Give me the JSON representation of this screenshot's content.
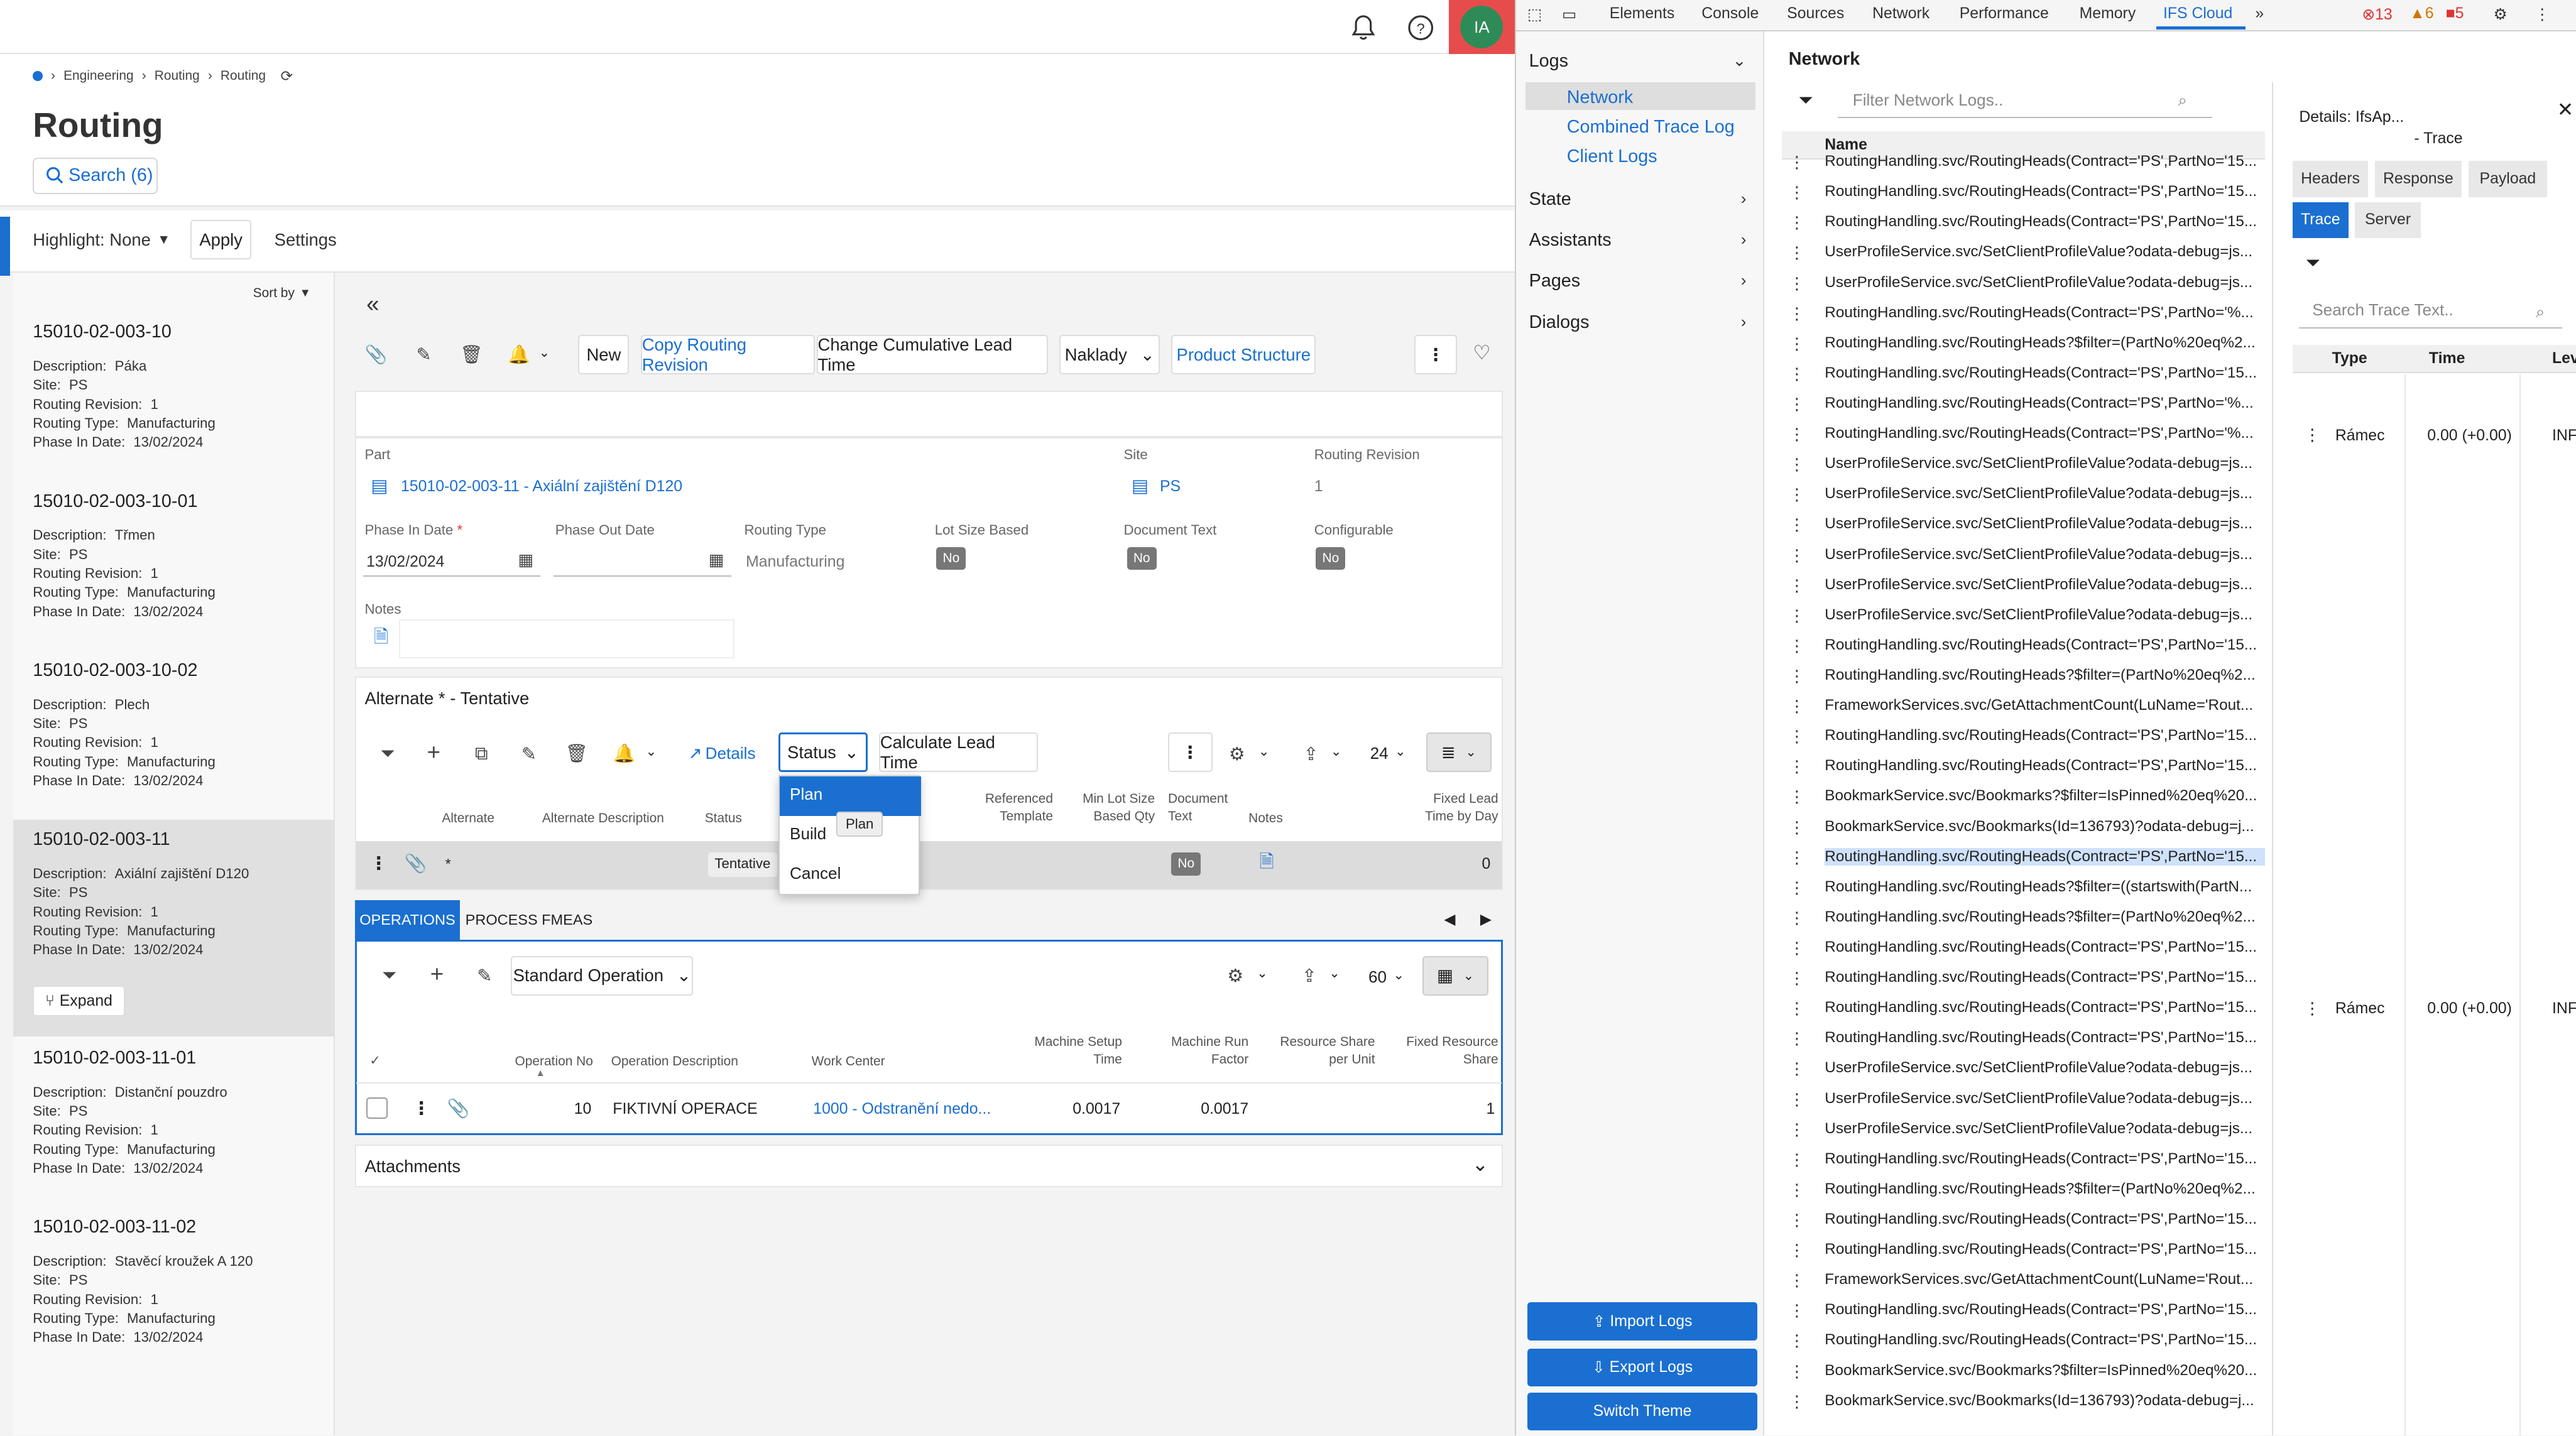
{
  "topbar": {
    "avatar_initials": "IA"
  },
  "breadcrumb": {
    "items": [
      "Engineering",
      "Routing",
      "Routing"
    ]
  },
  "page": {
    "title": "Routing",
    "search_label": "Search (6)"
  },
  "highlight": {
    "label": "Highlight: None",
    "apply": "Apply",
    "settings": "Settings"
  },
  "sort_label": "Sort by",
  "list_items": [
    {
      "id": "15010-02-003-10",
      "desc": "Páka",
      "site": "PS",
      "rev": "1",
      "type": "Manufacturing",
      "phase": "13/02/2024"
    },
    {
      "id": "15010-02-003-10-01",
      "desc": "Třmen",
      "site": "PS",
      "rev": "1",
      "type": "Manufacturing",
      "phase": "13/02/2024"
    },
    {
      "id": "15010-02-003-10-02",
      "desc": "Plech",
      "site": "PS",
      "rev": "1",
      "type": "Manufacturing",
      "phase": "13/02/2024"
    },
    {
      "id": "15010-02-003-11",
      "desc": "Axiální zajištění D120",
      "site": "PS",
      "rev": "1",
      "type": "Manufacturing",
      "phase": "13/02/2024"
    },
    {
      "id": "15010-02-003-11-01",
      "desc": "Distanční pouzdro",
      "site": "PS",
      "rev": "1",
      "type": "Manufacturing",
      "phase": "13/02/2024"
    },
    {
      "id": "15010-02-003-11-02",
      "desc": "Stavěcí kroužek A 120",
      "site": "PS",
      "rev": "1",
      "type": "Manufacturing",
      "phase": "13/02/2024"
    }
  ],
  "list_labels": {
    "desc": "Description:",
    "site": "Site:",
    "rev": "Routing Revision:",
    "type": "Routing Type:",
    "phase": "Phase In Date:",
    "expand": "Expand"
  },
  "toolbar": {
    "new": "New",
    "copy": "Copy Routing Revision",
    "change": "Change Cumulative Lead Time",
    "naklady": "Naklady",
    "product": "Product Structure"
  },
  "header_form": {
    "part_label": "Part",
    "part_value": "15010-02-003-11 - Axiální zajištění D120",
    "site_label": "Site",
    "site_value": "PS",
    "rev_label": "Routing Revision",
    "rev_value": "1",
    "phase_in_label": "Phase In Date",
    "phase_in_value": "13/02/2024",
    "phase_out_label": "Phase Out Date",
    "routing_type_label": "Routing Type",
    "routing_type_value": "Manufacturing",
    "lot_label": "Lot Size Based",
    "lot_value": "No",
    "doc_label": "Document Text",
    "doc_value": "No",
    "config_label": "Configurable",
    "config_value": "No",
    "notes_label": "Notes"
  },
  "alternate": {
    "title": "Alternate * - Tentative",
    "details": "Details",
    "status": "Status",
    "calc": "Calculate Lead Time",
    "page_size": "24",
    "cols": [
      "Alternate",
      "Alternate Description",
      "Status",
      "Referenced Template",
      "Min Lot Size Based Qty",
      "Document Text",
      "Notes",
      "Fixed Lead Time by Day"
    ],
    "row": {
      "alt": "*",
      "status": "Tentative",
      "doc": "No",
      "lead": "0"
    },
    "status_options": [
      "Plan",
      "Build",
      "Cancel"
    ],
    "tooltip": "Plan"
  },
  "operations": {
    "tabs": [
      "OPERATIONS",
      "PROCESS FMEAS"
    ],
    "std_op": "Standard Operation",
    "page_size": "60",
    "cols": [
      "Operation No",
      "Operation Description",
      "Work Center",
      "Machine Setup Time",
      "Machine Run Factor",
      "Resource Share per Unit",
      "Fixed Resource Share"
    ],
    "row": {
      "op_no": "10",
      "desc": "FIKTIVNÍ OPERACE",
      "wc": "1000 - Odstranění nedo...",
      "setup": "0.0017",
      "run": "0.0017",
      "share": "1"
    }
  },
  "attachments": "Attachments",
  "devtools": {
    "tabs": [
      "Elements",
      "Console",
      "Sources",
      "Network",
      "Performance",
      "Memory",
      "IFS Cloud"
    ],
    "errors": "13",
    "warnings": "6",
    "issues": "5",
    "logs_title": "Logs",
    "log_items": [
      "Network",
      "Combined Trace Log",
      "Client Logs"
    ],
    "sections": [
      "State",
      "Assistants",
      "Pages",
      "Dialogs"
    ],
    "buttons": [
      "Import Logs",
      "Export Logs",
      "Switch Theme"
    ],
    "network_title": "Network",
    "filter_placeholder": "Filter Network Logs..",
    "name_col": "Name",
    "rows": [
      "RoutingHandling.svc/RoutingHeads(Contract='PS',PartNo='15...",
      "RoutingHandling.svc/RoutingHeads(Contract='PS',PartNo='15...",
      "RoutingHandling.svc/RoutingHeads(Contract='PS',PartNo='15...",
      "UserProfileService.svc/SetClientProfileValue?odata-debug=js...",
      "UserProfileService.svc/SetClientProfileValue?odata-debug=js...",
      "RoutingHandling.svc/RoutingHeads(Contract='PS',PartNo='%...",
      "RoutingHandling.svc/RoutingHeads?$filter=(PartNo%20eq%2...",
      "RoutingHandling.svc/RoutingHeads(Contract='PS',PartNo='15...",
      "RoutingHandling.svc/RoutingHeads(Contract='PS',PartNo='%...",
      "RoutingHandling.svc/RoutingHeads(Contract='PS',PartNo='%...",
      "UserProfileService.svc/SetClientProfileValue?odata-debug=js...",
      "UserProfileService.svc/SetClientProfileValue?odata-debug=js...",
      "UserProfileService.svc/SetClientProfileValue?odata-debug=js...",
      "UserProfileService.svc/SetClientProfileValue?odata-debug=js...",
      "UserProfileService.svc/SetClientProfileValue?odata-debug=js...",
      "UserProfileService.svc/SetClientProfileValue?odata-debug=js...",
      "RoutingHandling.svc/RoutingHeads(Contract='PS',PartNo='15...",
      "RoutingHandling.svc/RoutingHeads?$filter=(PartNo%20eq%2...",
      "FrameworkServices.svc/GetAttachmentCount(LuName='Rout...",
      "RoutingHandling.svc/RoutingHeads(Contract='PS',PartNo='15...",
      "RoutingHandling.svc/RoutingHeads(Contract='PS',PartNo='15...",
      "BookmarkService.svc/Bookmarks?$filter=IsPinned%20eq%20...",
      "BookmarkService.svc/Bookmarks(Id=136793)?odata-debug=j...",
      "RoutingHandling.svc/RoutingHeads(Contract='PS',PartNo='15...",
      "RoutingHandling.svc/RoutingHeads?$filter=((startswith(PartN...",
      "RoutingHandling.svc/RoutingHeads?$filter=(PartNo%20eq%2...",
      "RoutingHandling.svc/RoutingHeads(Contract='PS',PartNo='15...",
      "RoutingHandling.svc/RoutingHeads(Contract='PS',PartNo='15...",
      "RoutingHandling.svc/RoutingHeads(Contract='PS',PartNo='15...",
      "RoutingHandling.svc/RoutingHeads(Contract='PS',PartNo='15...",
      "UserProfileService.svc/SetClientProfileValue?odata-debug=js...",
      "UserProfileService.svc/SetClientProfileValue?odata-debug=js...",
      "UserProfileService.svc/SetClientProfileValue?odata-debug=js...",
      "RoutingHandling.svc/RoutingHeads(Contract='PS',PartNo='15...",
      "RoutingHandling.svc/RoutingHeads?$filter=(PartNo%20eq%2...",
      "RoutingHandling.svc/RoutingHeads(Contract='PS',PartNo='15...",
      "RoutingHandling.svc/RoutingHeads(Contract='PS',PartNo='15...",
      "FrameworkServices.svc/GetAttachmentCount(LuName='Rout...",
      "RoutingHandling.svc/RoutingHeads(Contract='PS',PartNo='15...",
      "RoutingHandling.svc/RoutingHeads(Contract='PS',PartNo='15...",
      "BookmarkService.svc/Bookmarks?$filter=IsPinned%20eq%20...",
      "BookmarkService.svc/Bookmarks(Id=136793)?odata-debug=j..."
    ],
    "selected_row": 23,
    "details_title": "Details: IfsAp...",
    "details_sub": "- Trace",
    "detail_tabs": [
      "Headers",
      "Response",
      "Payload",
      "Trace",
      "Server"
    ],
    "trace_placeholder": "Search Trace Text..",
    "trace_cols": [
      "Type",
      "Time",
      "Lev"
    ],
    "trace_rows": [
      {
        "type": "Rámec",
        "time": "0.00 (+0.00)",
        "lev": "INF"
      },
      {
        "type": "Rámec",
        "time": "0.00 (+0.00)",
        "lev": "INF"
      }
    ]
  }
}
